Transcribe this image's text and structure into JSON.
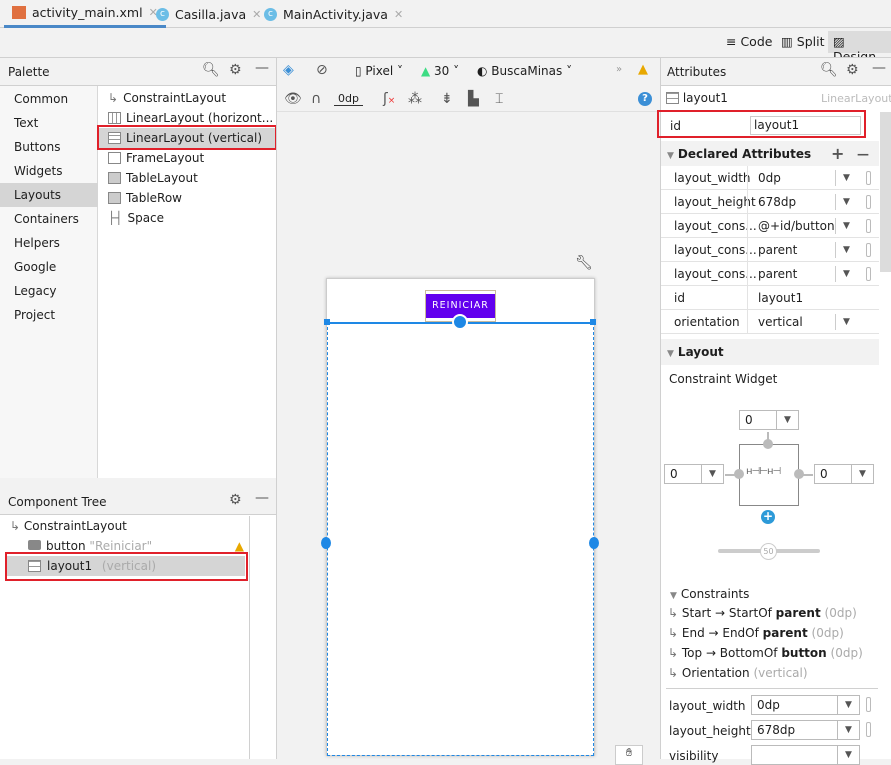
{
  "tabs": [
    {
      "label": "activity_main.xml",
      "active": true,
      "icon": "xml-file-icon"
    },
    {
      "label": "Casilla.java",
      "icon": "class-icon"
    },
    {
      "label": "MainActivity.java",
      "icon": "class-icon"
    }
  ],
  "view_modes": {
    "code": "Code",
    "split": "Split",
    "design": "Design",
    "selected": "Design"
  },
  "palette": {
    "title": "Palette",
    "categories": [
      "Common",
      "Text",
      "Buttons",
      "Widgets",
      "Layouts",
      "Containers",
      "Helpers",
      "Google",
      "Legacy",
      "Project"
    ],
    "selected_category": "Layouts",
    "items": [
      "ConstraintLayout",
      "LinearLayout (horizont...",
      "LinearLayout (vertical)",
      "FrameLayout",
      "TableLayout",
      "TableRow",
      "Space"
    ],
    "selected_item": "LinearLayout (vertical)"
  },
  "design_toolbar": {
    "device": "Pixel",
    "api": "30",
    "theme": "BuscaMinas",
    "margin": "0dp"
  },
  "canvas": {
    "button_label": "REINICIAR",
    "button_color": "#6200ee",
    "selection_color": "#1e88e5"
  },
  "component_tree": {
    "title": "Component Tree",
    "items": [
      {
        "name": "ConstraintLayout",
        "detail": ""
      },
      {
        "name": "button",
        "detail": "\"Reiniciar\"",
        "warning": true
      },
      {
        "name": "layout1",
        "detail": "(vertical)",
        "selected": true
      }
    ]
  },
  "attributes": {
    "title": "Attributes",
    "component_name": "layout1",
    "component_type": "LinearLayout",
    "id_label": "id",
    "id_value": "layout1",
    "declared_title": "Declared Attributes",
    "declared": [
      {
        "k": "layout_width",
        "v": "0dp",
        "dd": true
      },
      {
        "k": "layout_height",
        "v": "678dp",
        "dd": true
      },
      {
        "k": "layout_cons...",
        "v": "@+id/button",
        "dd": true
      },
      {
        "k": "layout_cons...",
        "v": "parent",
        "dd": true
      },
      {
        "k": "layout_cons...",
        "v": "parent",
        "dd": true
      },
      {
        "k": "id",
        "v": "layout1",
        "dd": false
      },
      {
        "k": "orientation",
        "v": "vertical",
        "dd": true
      }
    ],
    "layout_title": "Layout",
    "constraint_widget": "Constraint Widget",
    "margins": {
      "top": "0",
      "left": "0",
      "right": "0"
    },
    "bias": "50",
    "constraints_title": "Constraints",
    "constraints": [
      {
        "a": "Start → StartOf ",
        "b": "parent",
        "c": "(0dp)"
      },
      {
        "a": "End → EndOf ",
        "b": "parent",
        "c": "(0dp)"
      },
      {
        "a": "Top → BottomOf ",
        "b": "button",
        "c": "(0dp)"
      },
      {
        "a": "Orientation ",
        "b": "",
        "c": "(vertical)"
      }
    ],
    "bottom": [
      {
        "k": "layout_width",
        "v": "0dp"
      },
      {
        "k": "layout_height",
        "v": "678dp"
      },
      {
        "k": "visibility",
        "v": ""
      }
    ]
  }
}
